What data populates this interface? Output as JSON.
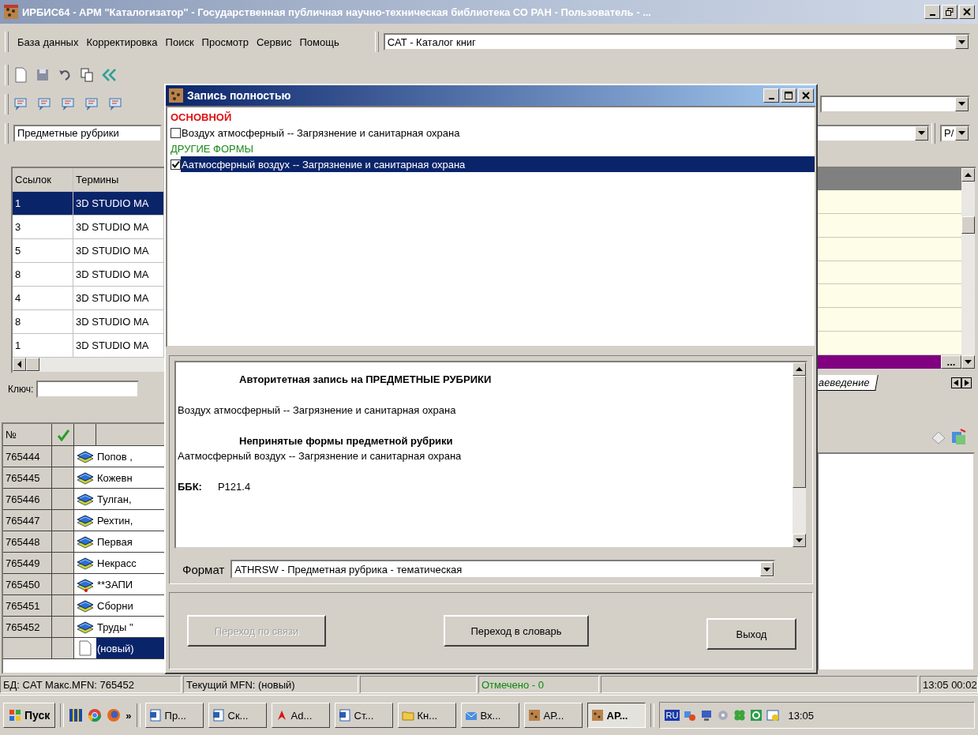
{
  "window": {
    "title": "ИРБИС64 - АРМ \"Каталогизатор\" - Государственная публичная научно-техническая библиотека СО РАН - Пользователь - ..."
  },
  "menu": [
    "База данных",
    "Корректировка",
    "Поиск",
    "Просмотр",
    "Сервис",
    "Помощь"
  ],
  "database_combo": {
    "value": "CAT - Каталог книг"
  },
  "dictionary_combo": {
    "value": "Предметные рубрики"
  },
  "small_combo": {
    "value": "Р/"
  },
  "terms_table": {
    "columns": [
      "Ссылок",
      "Термины"
    ],
    "rows": [
      {
        "links": "1",
        "term": "3D STUDIO MA",
        "selected": true
      },
      {
        "links": "3",
        "term": "3D STUDIO MA",
        "selected": false
      },
      {
        "links": "5",
        "term": "3D STUDIO MA",
        "selected": false
      },
      {
        "links": "8",
        "term": "3D STUDIO MA",
        "selected": false
      },
      {
        "links": "4",
        "term": "3D STUDIO MA",
        "selected": false
      },
      {
        "links": "8",
        "term": "3D STUDIO MA",
        "selected": false
      },
      {
        "links": "1",
        "term": "3D STUDIO MA",
        "selected": false
      }
    ]
  },
  "key_field": {
    "label": "Ключ:"
  },
  "sheet_tab": {
    "label": "аеведение"
  },
  "ellipsis_button": {
    "label": "..."
  },
  "records_table": {
    "number_column": "№",
    "rows": [
      {
        "mfn": "765444",
        "title": "Попов ,",
        "kind": "book",
        "selected": false
      },
      {
        "mfn": "765445",
        "title": "Кожевн",
        "kind": "book",
        "selected": false
      },
      {
        "mfn": "765446",
        "title": "Тулган,",
        "kind": "book",
        "selected": false
      },
      {
        "mfn": "765447",
        "title": "Рехтин,",
        "kind": "book",
        "selected": false
      },
      {
        "mfn": "765448",
        "title": "Первая",
        "kind": "book",
        "selected": false
      },
      {
        "mfn": "765449",
        "title": "Некрасс",
        "kind": "book",
        "selected": false
      },
      {
        "mfn": "765450",
        "title": "**ЗАПИ",
        "kind": "book-marked",
        "selected": false
      },
      {
        "mfn": "765451",
        "title": "Сборни",
        "kind": "book",
        "selected": false
      },
      {
        "mfn": "765452",
        "title": "Труды \"",
        "kind": "book",
        "selected": false
      },
      {
        "title": "(новый)",
        "kind": "new",
        "selected": true
      }
    ]
  },
  "status_bar": [
    {
      "text": "БД: CAT Макс.MFN: 765452",
      "kind": "normal"
    },
    {
      "text": "Текущий MFN: (новый)",
      "kind": "normal"
    },
    {
      "kind": "empty"
    },
    {
      "text": "Отмечено - 0",
      "kind": "marked"
    },
    {
      "kind": "empty"
    },
    {
      "text": "13:05 00:02",
      "kind": "normal"
    }
  ],
  "taskbar": {
    "start": "Пуск",
    "more": "»",
    "tasks": [
      {
        "label": "Пр...",
        "kind": "word",
        "selected": false
      },
      {
        "label": "Ск...",
        "kind": "word",
        "selected": false
      },
      {
        "label": "Ad...",
        "kind": "pdf",
        "selected": false
      },
      {
        "label": "Ст...",
        "kind": "word",
        "selected": false
      },
      {
        "label": "Кн...",
        "kind": "folder",
        "selected": false
      },
      {
        "label": "Вх...",
        "kind": "mail",
        "selected": false
      },
      {
        "label": "АР...",
        "kind": "irbis",
        "selected": false
      },
      {
        "label": "АР...",
        "kind": "irbis",
        "selected": true
      }
    ],
    "language": "RU",
    "clock": "13:05"
  },
  "dialog": {
    "title": "Запись полностью",
    "list": [
      {
        "kind": "main-heading",
        "text": "ОСНОВНОЙ"
      },
      {
        "kind": "item",
        "text": "Воздух атмосферный -- Загрязнение и санитарная охрана",
        "checked": false,
        "selected": false
      },
      {
        "kind": "other-heading",
        "text": "ДРУГИЕ ФОРМЫ"
      },
      {
        "kind": "item",
        "text": "Аатмосферный воздух -- Загрязнение и санитарная охрана",
        "checked": true,
        "selected": true
      }
    ],
    "record": [
      {
        "kind": "heading",
        "text": "Авторитетная запись на ПРЕДМЕТНЫЕ РУБРИКИ"
      },
      {
        "kind": "text",
        "text": "Воздух атмосферный -- Загрязнение и санитарная охрана"
      },
      {
        "kind": "heading",
        "text": "Непринятые формы предметной рубрики"
      },
      {
        "kind": "text",
        "text": "Аатмосферный воздух -- Загрязнение и санитарная охрана"
      },
      {
        "kind": "field",
        "label": "ББК:",
        "value": "P121.4"
      }
    ],
    "format": {
      "label": "Формат",
      "value": "ATHRSW - Предметная рубрика - тематическая"
    },
    "buttons": [
      {
        "label": "Переход по связи",
        "disabled": true
      },
      {
        "label": "Переход в словарь",
        "disabled": false
      },
      {
        "label": "Выход",
        "disabled": false
      }
    ]
  }
}
